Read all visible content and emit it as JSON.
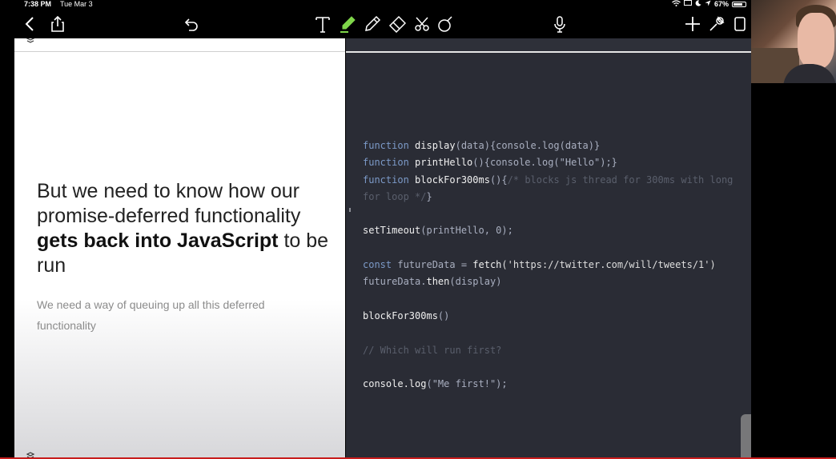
{
  "status": {
    "time": "7:38 PM",
    "date": "Tue Mar 3",
    "battery": "67%"
  },
  "toolbar": {
    "icons": [
      "chevron-left-icon",
      "share-icon",
      "undo-icon",
      "text-tool-icon",
      "highlighter-icon",
      "pen-icon",
      "eraser-icon",
      "lasso-scissors-icon",
      "shapes-icon",
      "microphone-icon",
      "plus-icon",
      "wrench-icon",
      "page-icon"
    ],
    "highlight_color": "#7fd64a"
  },
  "slide": {
    "heading_part1": "But we need to know how our promise-deferred functionality ",
    "heading_bold1": "gets back into JavaScript",
    "heading_part2": " to be run",
    "subtext": "We need a way of queuing up all this deferred functionality"
  },
  "code": {
    "l1_kw": "function",
    "l1_fn": "display",
    "l1_rest": "(data){console.log(data)}",
    "l2_kw": "function",
    "l2_fn": "printHello",
    "l2_rest": "(){console.log(\"Hello\");}",
    "l3_kw": "function",
    "l3_fn": "blockFor300ms",
    "l3_open": "(){",
    "l3_comment": "/* blocks js thread for 300ms with long for loop */",
    "l3_close": "}",
    "l5_fn": "setTimeout",
    "l5_rest": "(printHello, 0);",
    "l7_kw": "const",
    "l7_var": " futureData = ",
    "l7_fn": "fetch",
    "l7_rest": "('https://twitter.com/will/tweets/1')",
    "l8_var": "futureData.",
    "l8_fn": "then",
    "l8_rest": "(display)",
    "l10_fn": "blockFor300ms",
    "l10_rest": "()",
    "l12_comment": "// Which will run first?",
    "l14_fn": "console.log",
    "l14_rest": "(\"Me first!\");"
  },
  "colors": {
    "code_bg": "#2a2c35",
    "keyword": "#7c9ac8",
    "comment": "#5a5f6c"
  }
}
